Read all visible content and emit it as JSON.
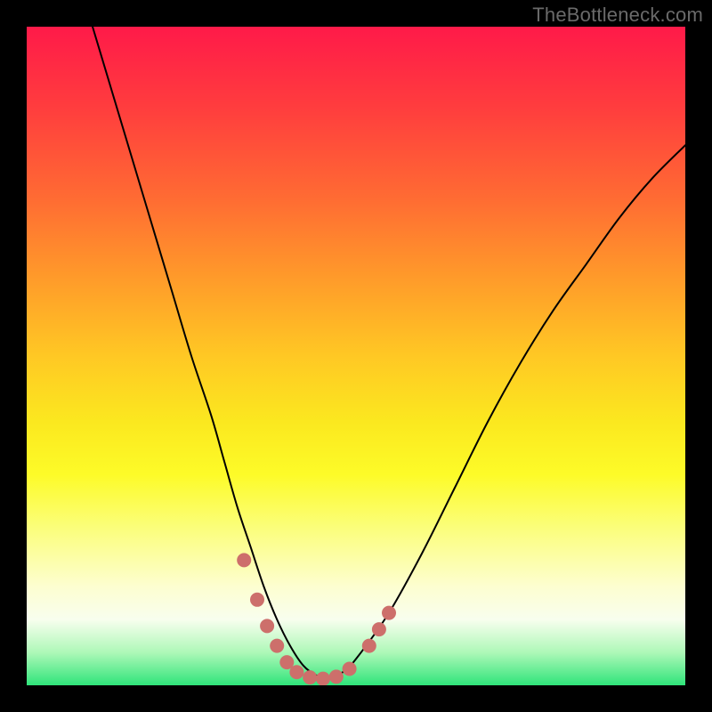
{
  "watermark": "TheBottleneck.com",
  "colors": {
    "gradient_top": "#ff1a49",
    "gradient_mid": "#fdfb28",
    "gradient_bottom": "#2fe47a",
    "frame": "#000000",
    "curve": "#000000",
    "marker": "#cd6f6b",
    "watermark_text": "#6a6a6a"
  },
  "chart_data": {
    "type": "line",
    "title": "",
    "xlabel": "",
    "ylabel": "",
    "xlim": [
      0,
      100
    ],
    "ylim": [
      0,
      100
    ],
    "x": [
      10,
      13,
      16,
      19,
      22,
      25,
      28,
      30,
      32,
      34,
      36,
      38,
      40,
      42,
      44,
      46,
      48,
      50,
      55,
      60,
      65,
      70,
      75,
      80,
      85,
      90,
      95,
      100
    ],
    "values": [
      100,
      90,
      80,
      70,
      60,
      50,
      41,
      34,
      27,
      21,
      15,
      10,
      6,
      3,
      1.5,
      1,
      2,
      4,
      11,
      20,
      30,
      40,
      49,
      57,
      64,
      71,
      77,
      82
    ],
    "markers": [
      {
        "x": 33,
        "y": 19
      },
      {
        "x": 35,
        "y": 13
      },
      {
        "x": 36.5,
        "y": 9
      },
      {
        "x": 38,
        "y": 6
      },
      {
        "x": 39.5,
        "y": 3.5
      },
      {
        "x": 41,
        "y": 2
      },
      {
        "x": 43,
        "y": 1.2
      },
      {
        "x": 45,
        "y": 1
      },
      {
        "x": 47,
        "y": 1.3
      },
      {
        "x": 49,
        "y": 2.5
      },
      {
        "x": 52,
        "y": 6
      },
      {
        "x": 53.5,
        "y": 8.5
      },
      {
        "x": 55,
        "y": 11
      }
    ],
    "grid": false,
    "legend": false
  }
}
